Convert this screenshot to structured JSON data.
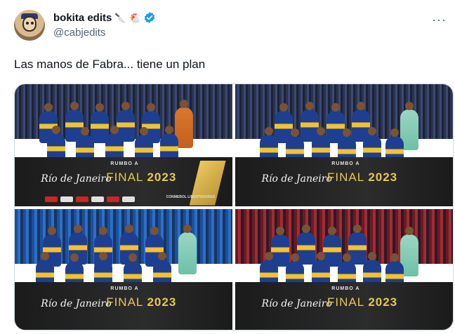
{
  "tweet": {
    "display_name": "bokita edits",
    "name_emojis": [
      "🔪",
      "🐔"
    ],
    "handle": "@cabjedits",
    "text": "Las manos de Fabra... tiene un plan",
    "more_label": "···"
  },
  "media": {
    "photos": [
      {
        "banner_rumbo": "RUMBO A",
        "banner_city": "Río de Janeiro",
        "banner_final": "FINAL",
        "banner_year": "2023",
        "banner_sponsor_text": "CONMEBOL LIBERTADORES",
        "stand": "dark"
      },
      {
        "banner_rumbo": "RUMBO A",
        "banner_city": "Río de Janeiro",
        "banner_final": "FINAL",
        "banner_year": "2023",
        "stand": "dark"
      },
      {
        "banner_rumbo": "RUMBO A",
        "banner_city": "Río de Janeiro",
        "banner_final": "FINAL",
        "banner_year": "2023",
        "stand": "blue"
      },
      {
        "banner_rumbo": "RUMBO A",
        "banner_city": "Río de Janeiro",
        "banner_final": "FINAL",
        "banner_year": "2023",
        "stand": "red"
      }
    ]
  },
  "colors": {
    "verified": "#1d9bf0",
    "text_primary": "#0f1419",
    "text_secondary": "#536471",
    "boca_blue": "#1e3f8f",
    "boca_gold": "#f2c230"
  },
  "icons": [
    "verified-badge-icon",
    "more-options-icon",
    "knife-emoji",
    "rooster-emoji"
  ]
}
